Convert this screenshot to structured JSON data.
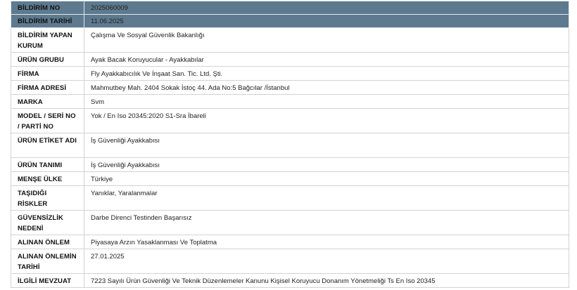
{
  "rows": [
    {
      "label": "BİLDİRİM NO",
      "value": "2025060009",
      "header": true
    },
    {
      "label": "BİLDİRİM TARİHİ",
      "value": "11.06.2025",
      "header": true
    },
    {
      "label": "BİLDİRİM YAPAN KURUM",
      "value": "Çalışma Ve Sosyal Güvenlik Bakanlığı"
    },
    {
      "label": "ÜRÜN GRUBU",
      "value": "Ayak Bacak Koruyucular - Ayakkabılar"
    },
    {
      "label": "FİRMA",
      "value": "Fly Ayakkabıcılık Ve İnşaat San. Tic. Ltd. Şti."
    },
    {
      "label": "FİRMA ADRESİ",
      "value": "Mahmutbey Mah. 2404 Sokak İstoç 44. Ada No:5 Bağcılar /İstanbul"
    },
    {
      "label": "MARKA",
      "value": "Svm"
    },
    {
      "label": "MODEL / SERİ NO / PARTİ NO",
      "value": "Yok / En Iso 20345:2020 S1-Sra İbareli"
    },
    {
      "label": "ÜRÜN ETİKET ADI",
      "value": "İş Güvenliği Ayakkabısı"
    },
    {
      "label": "ÜRÜN TANIMI",
      "value": "İş Güvenliği Ayakkabısı"
    },
    {
      "label": "MENŞE ÜLKE",
      "value": "Türkiye"
    },
    {
      "label": "TAŞIDIĞI RİSKLER",
      "value": "Yanıklar, Yaralanmalar"
    },
    {
      "label": "GÜVENSİZLİK NEDENİ",
      "value": "Darbe Direnci Testinden Başarısız"
    },
    {
      "label": "ALINAN ÖNLEM",
      "value": "Piyasaya Arzın Yasaklanması Ve Toplatma"
    },
    {
      "label": "ALINAN ÖNLEMİN TARİHİ",
      "value": "27.01.2025"
    },
    {
      "label": "İLGİLİ MEVZUAT",
      "value": "7223 Sayılı Ürün Güvenliği Ve Teknik Düzenlemeler Kanunu Kişisel Koruyucu Donanım Yönetmeliği Ts En Iso 20345"
    }
  ]
}
